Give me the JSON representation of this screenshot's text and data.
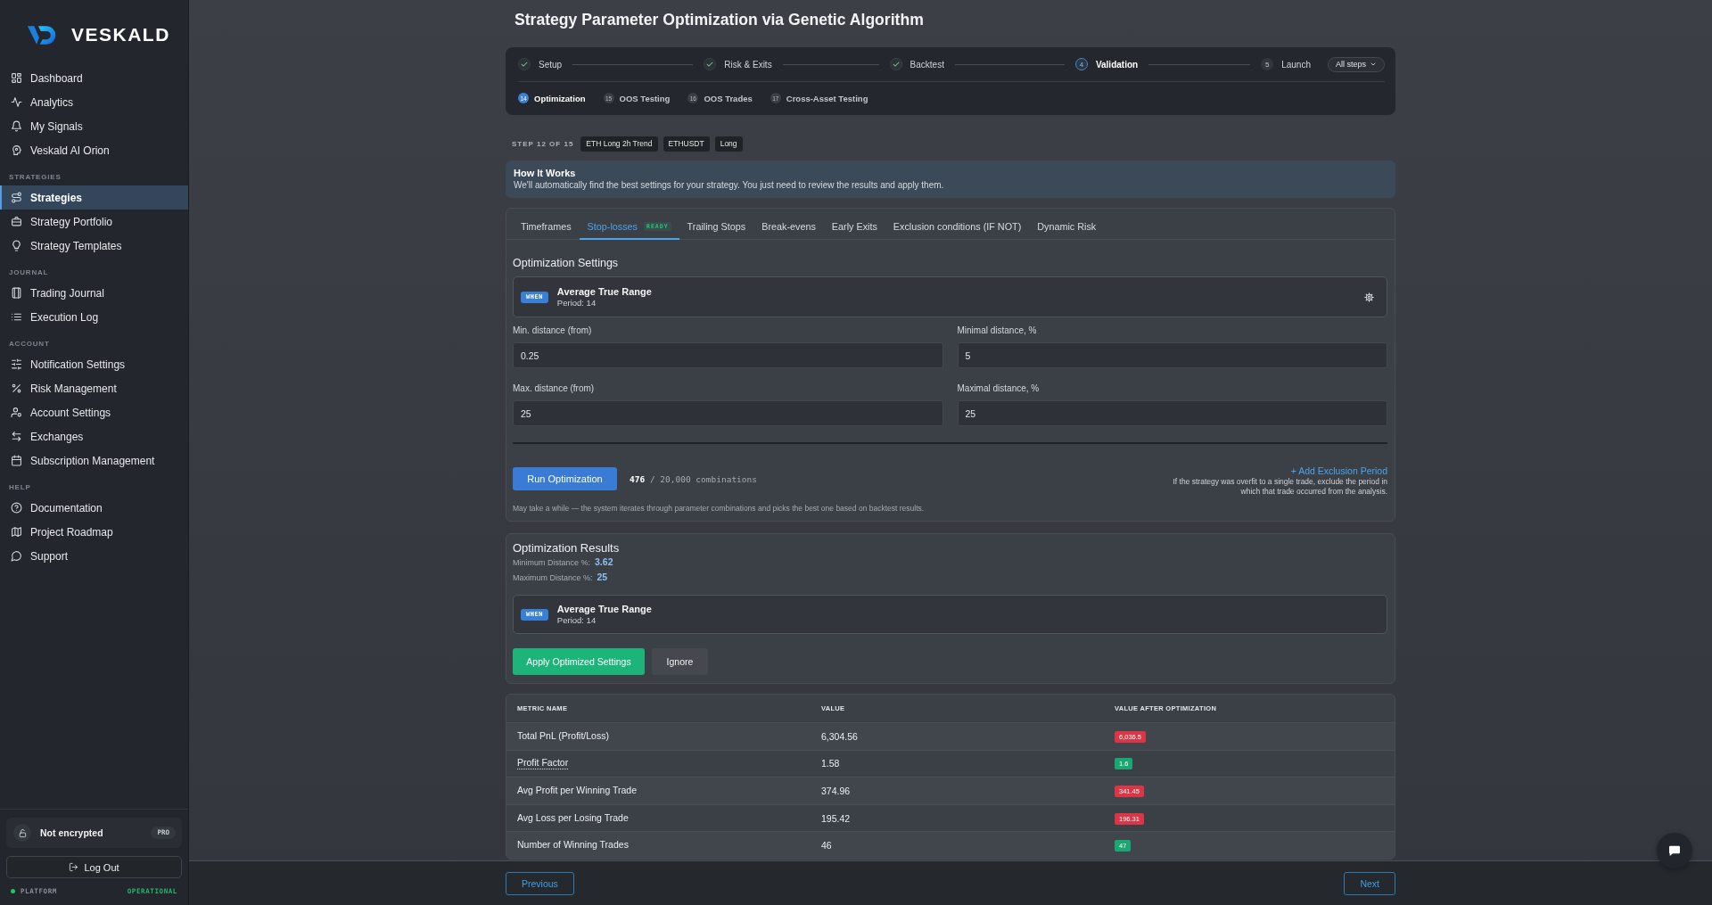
{
  "sidebar": {
    "logo": "VESKALD",
    "sections": [
      {
        "items": [
          {
            "label": "Dashboard",
            "selected": false
          },
          {
            "label": "Analytics",
            "selected": false
          },
          {
            "label": "My Signals",
            "selected": false
          },
          {
            "label": "Veskald AI Orion",
            "selected": false
          }
        ]
      },
      {
        "title": "STRATEGIES",
        "items": [
          {
            "label": "Strategies",
            "selected": true
          },
          {
            "label": "Strategy Portfolio",
            "selected": false
          },
          {
            "label": "Strategy Templates",
            "selected": false
          }
        ]
      },
      {
        "title": "JOURNAL",
        "items": [
          {
            "label": "Trading Journal",
            "selected": false
          },
          {
            "label": "Execution Log",
            "selected": false
          }
        ]
      },
      {
        "title": "ACCOUNT",
        "items": [
          {
            "label": "Notification Settings",
            "selected": false
          },
          {
            "label": "Risk Management",
            "selected": false
          },
          {
            "label": "Account Settings",
            "selected": false
          },
          {
            "label": "Exchanges",
            "selected": false
          },
          {
            "label": "Subscription Management",
            "selected": false
          }
        ]
      },
      {
        "title": "HELP",
        "items": [
          {
            "label": "Documentation",
            "selected": false
          },
          {
            "label": "Project Roadmap",
            "selected": false
          },
          {
            "label": "Support",
            "selected": false
          }
        ]
      }
    ],
    "security": {
      "label": "Not encrypted",
      "badge": "PRO"
    },
    "logout": "Log Out",
    "status": {
      "label": "PLATFORM",
      "value": "OPERATIONAL",
      "operational": true
    }
  },
  "page": {
    "title": "Strategy Parameter Optimization via Genetic Algorithm"
  },
  "stepper": {
    "steps": [
      {
        "label": "Setup",
        "completed": true,
        "current": false
      },
      {
        "label": "Risk & Exits",
        "completed": true,
        "current": false
      },
      {
        "label": "Backtest",
        "completed": true,
        "current": false
      },
      {
        "label": "Validation",
        "completed": false,
        "current": true,
        "number": "4"
      },
      {
        "label": "Launch",
        "completed": false,
        "current": false,
        "number": "5"
      }
    ],
    "menu": "All steps",
    "substeps": [
      {
        "number": "14",
        "label": "Optimization",
        "selected": true
      },
      {
        "number": "15",
        "label": "OOS Testing",
        "selected": false
      },
      {
        "number": "16",
        "label": "OOS Trades",
        "selected": false
      },
      {
        "number": "17",
        "label": "Cross-Asset Testing",
        "selected": false
      }
    ]
  },
  "step_info": {
    "label": "STEP 12 OF 15",
    "tags": [
      "ETH Long 2h Trend",
      "ETHUSDT",
      "Long"
    ]
  },
  "how_it_works": {
    "title": "How It Works",
    "text": "We'll automatically find the best settings for your strategy. You just need to review the results and apply them."
  },
  "settings": {
    "tabs": [
      {
        "label": "Timeframes",
        "selected": false
      },
      {
        "label": "Stop-losses",
        "selected": true,
        "badge": "READY"
      },
      {
        "label": "Trailing Stops",
        "selected": false
      },
      {
        "label": "Break-evens",
        "selected": false
      },
      {
        "label": "Early Exits",
        "selected": false
      },
      {
        "label": "Exclusion conditions (IF NOT)",
        "selected": false
      },
      {
        "label": "Dynamic Risk",
        "selected": false
      }
    ],
    "heading": "Optimization Settings",
    "indicator": {
      "badge": "WHEN",
      "name": "Average True Range",
      "detail": "Period: 14",
      "configurable": true
    },
    "fields": [
      {
        "label": "Min. distance (from)",
        "value": "0.25"
      },
      {
        "label": "Minimal distance, %",
        "value": "5"
      },
      {
        "label": "Max. distance (from)",
        "value": "25"
      },
      {
        "label": "Maximal distance, %",
        "value": "25"
      }
    ],
    "run_button": "Run Optimization",
    "combinations": "**476** / 20,000 combinations",
    "exclusion_link": "+ Add Exclusion Period",
    "exclusion_note": "If the strategy was overfit to a single trade, exclude the period in which that trade occurred from the analysis.",
    "hint": "May take a while — the system iterates through parameter combinations and picks the best one based on backtest results."
  },
  "results": {
    "title": "Optimization Results",
    "params": [
      {
        "label": "Minimum Distance %:",
        "value": "3.62"
      },
      {
        "label": "Maximum Distance %:",
        "value": "25"
      }
    ],
    "indicator": {
      "badge": "WHEN",
      "name": "Average True Range",
      "detail": "Period: 14",
      "configurable": false
    },
    "buttons": [
      {
        "label": "Apply Optimized Settings",
        "kind": "primary"
      },
      {
        "label": "Ignore",
        "kind": "secondary"
      }
    ]
  },
  "table": {
    "columns": [
      "METRIC NAME",
      "VALUE",
      "VALUE AFTER OPTIMIZATION"
    ],
    "rows": [
      {
        "metric": "Total PnL (Profit/Loss)",
        "has_tooltip": false,
        "value": "6,304.56",
        "optimized": "6,036.5",
        "color": "#dc3545"
      },
      {
        "metric": "Profit Factor",
        "has_tooltip": true,
        "value": "1.58",
        "optimized": "1.6",
        "color": "#1aa870"
      },
      {
        "metric": "Avg Profit per Winning Trade",
        "has_tooltip": false,
        "value": "374.96",
        "optimized": "341.45",
        "color": "#dc3545"
      },
      {
        "metric": "Avg Loss per Losing Trade",
        "has_tooltip": false,
        "value": "195.42",
        "optimized": "196.31",
        "color": "#dc3545"
      },
      {
        "metric": "Number of Winning Trades",
        "has_tooltip": false,
        "value": "46",
        "optimized": "47",
        "color": "#1aa870"
      }
    ]
  },
  "footer": {
    "previous": "Previous",
    "next": "Next"
  }
}
